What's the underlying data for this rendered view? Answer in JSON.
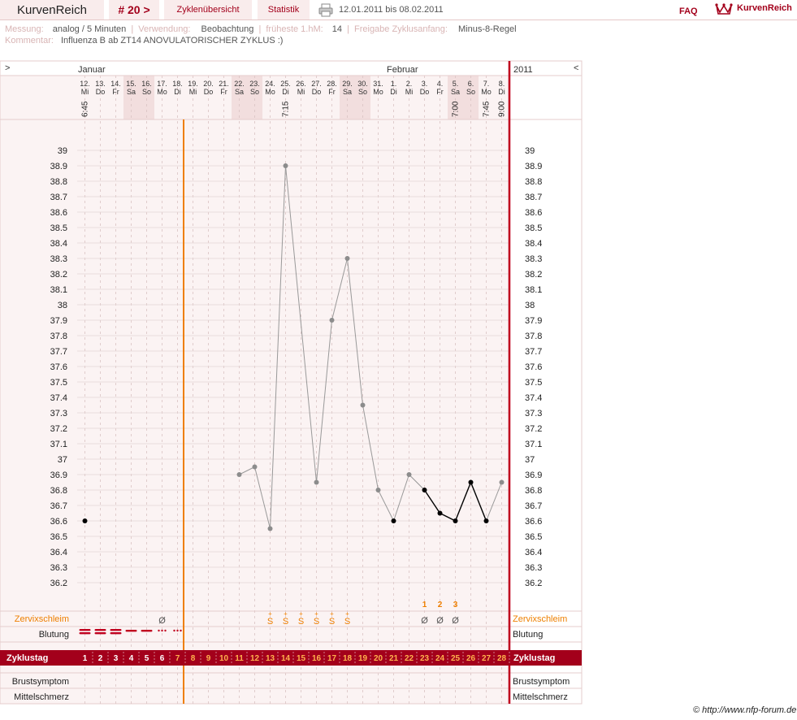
{
  "header": {
    "app_name": "KurvenReich",
    "cycle": "# 20 >",
    "nav": [
      "Zyklenübersicht",
      "Statistik"
    ],
    "range": "12.01.2011 bis 08.02.2011",
    "faq": "FAQ",
    "brand": "KurvenReich",
    "icons": [
      "printer-icon",
      "crown-icon"
    ]
  },
  "meta": {
    "messung_label": "Messung:",
    "messung_value": "analog / 5 Minuten",
    "verwendung_label": "Verwendung:",
    "verwendung_value": "Beobachtung",
    "fhm_label": "früheste 1.hM:",
    "fhm_value": "14",
    "freigabe_label": "Freigabe Zyklusanfang:",
    "freigabe_value": "Minus-8-Regel",
    "kommentar_label": "Kommentar:",
    "kommentar_value": "Influenza B ab ZT14 ANOVULATORISCHER ZYKLUS :)"
  },
  "chart_data": {
    "type": "line",
    "nav_left": ">",
    "nav_right": "<",
    "months": [
      "Januar",
      "Februar"
    ],
    "year": "2011",
    "day_numbers": [
      "12.",
      "13.",
      "14.",
      "15.",
      "16.",
      "17.",
      "18.",
      "19.",
      "20.",
      "21.",
      "22.",
      "23.",
      "24.",
      "25.",
      "26.",
      "27.",
      "28.",
      "29.",
      "30.",
      "31.",
      "1.",
      "2.",
      "3.",
      "4.",
      "5.",
      "6.",
      "7.",
      "8."
    ],
    "weekdays": [
      "Mi",
      "Do",
      "Fr",
      "Sa",
      "So",
      "Mo",
      "Di",
      "Mi",
      "Do",
      "Fr",
      "Sa",
      "So",
      "Mo",
      "Di",
      "Mi",
      "Do",
      "Fr",
      "Sa",
      "So",
      "Mo",
      "Di",
      "Mi",
      "Do",
      "Fr",
      "Sa",
      "So",
      "Mo",
      "Di"
    ],
    "weekend_shaded": [
      3,
      4,
      10,
      11,
      17,
      18,
      24,
      25
    ],
    "measure_times": [
      "6:45",
      "",
      "",
      "",
      "",
      "",
      "",
      "",
      "",
      "",
      "",
      "",
      "",
      "7:15",
      "",
      "",
      "",
      "",
      "",
      "",
      "",
      "",
      "",
      "",
      "7:00",
      "",
      "7:45",
      "9:00"
    ],
    "y_ticks": [
      "39",
      "38.9",
      "38.8",
      "38.7",
      "38.6",
      "38.5",
      "38.4",
      "38.3",
      "38.2",
      "38.1",
      "38",
      "37.9",
      "37.8",
      "37.7",
      "37.6",
      "37.5",
      "37.4",
      "37.3",
      "37.2",
      "37.1",
      "37",
      "36.9",
      "36.8",
      "36.7",
      "36.6",
      "36.5",
      "36.4",
      "36.3",
      "36.2"
    ],
    "ylim": [
      36.2,
      39.0
    ],
    "temperatures": [
      36.6,
      null,
      null,
      null,
      null,
      null,
      null,
      null,
      null,
      null,
      36.9,
      36.95,
      36.55,
      38.9,
      null,
      36.85,
      37.9,
      38.3,
      37.35,
      36.8,
      36.6,
      36.9,
      36.8,
      36.65,
      36.6,
      36.85,
      36.6,
      36.85
    ],
    "evaluated_days": [
      0,
      20,
      22,
      23,
      24,
      25,
      26
    ],
    "evaluated_segment": [
      22,
      23,
      24,
      25,
      26
    ],
    "coverline_after_day": 6,
    "cycle_days": [
      "1",
      "2",
      "3",
      "4",
      "5",
      "6",
      "7",
      "8",
      "9",
      "10",
      "11",
      "12",
      "13",
      "14",
      "15",
      "16",
      "17",
      "18",
      "19",
      "20",
      "21",
      "22",
      "23",
      "24",
      "25",
      "26",
      "27",
      "28"
    ],
    "peak_count": {
      "22": "1",
      "23": "2",
      "24": "3"
    },
    "cervix_marks": {
      "5": "Ø",
      "12": "S+",
      "13": "S+",
      "14": "S+",
      "15": "S+",
      "16": "S+",
      "17": "S+",
      "22": "Ø",
      "23": "Ø",
      "24": "Ø"
    },
    "cervix_plus": "+",
    "cervix_s": "S",
    "bleeding": {
      "0": "heavy",
      "1": "heavy",
      "2": "heavy",
      "3": "medium",
      "4": "medium",
      "5": "light",
      "6": "light"
    },
    "row_labels": {
      "zervix": "Zervixschleim",
      "blutung": "Blutung",
      "zyklustag": "Zyklustag",
      "brust": "Brustsymptom",
      "mittel": "Mittelschmerz"
    },
    "colors": {
      "accent": "#a3001b",
      "orange": "#ee7f00",
      "grey_line": "#999999",
      "dot_grey": "#8c8c8c",
      "dot_black": "#000000",
      "panel": "#fbf3f3",
      "weekend": "#f2dede"
    }
  },
  "footer": {
    "credit": "© http://www.nfp-forum.de"
  }
}
